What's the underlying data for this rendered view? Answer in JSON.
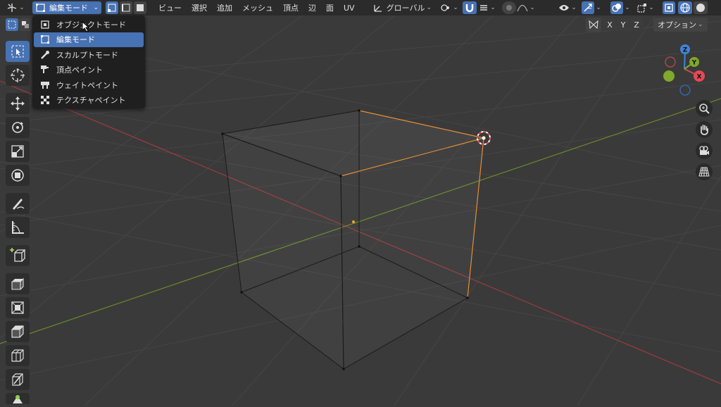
{
  "header": {
    "mode_label": "編集モード",
    "menus": [
      "ビュー",
      "選択",
      "追加",
      "メッシュ",
      "頂点",
      "辺",
      "面",
      "UV"
    ],
    "transform_orientation": "グローバル"
  },
  "mode_dropdown": {
    "items": [
      {
        "label": "オブジェクトモード",
        "icon": "object-mode-icon"
      },
      {
        "label": "編集モード",
        "icon": "edit-mode-icon"
      },
      {
        "label": "スカルプトモード",
        "icon": "sculpt-mode-icon"
      },
      {
        "label": "頂点ペイント",
        "icon": "vertex-paint-icon"
      },
      {
        "label": "ウェイトペイント",
        "icon": "weight-paint-icon"
      },
      {
        "label": "テクスチャペイント",
        "icon": "texture-paint-icon"
      }
    ],
    "active_index": 1
  },
  "viewport": {
    "mirror_axes": [
      "X",
      "Y",
      "Z"
    ],
    "options_label": "オプション",
    "gizmo_labels": {
      "z": "Z",
      "y": "Y",
      "x": "X"
    }
  },
  "colors": {
    "accent": "#4772b3",
    "x_axis": "#d14a52",
    "y_axis": "#7fa92a",
    "z_axis": "#3d85d6",
    "selection": "#f5a623"
  }
}
